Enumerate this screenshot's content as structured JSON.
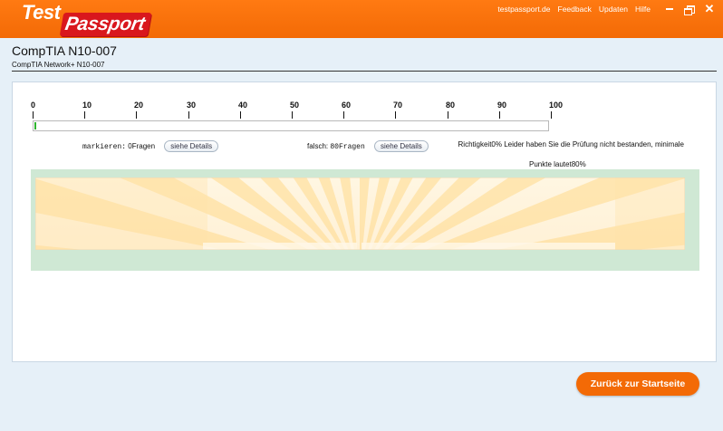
{
  "brand": {
    "logo_test": "Test",
    "logo_passport": "Passport",
    "color_primary": "#f36a06",
    "color_logo_badge": "#d9171d"
  },
  "topnav": {
    "links": [
      "testpassport.de",
      "Feedback",
      "Updaten",
      "Hilfe"
    ],
    "window_controls": [
      "minimize-icon",
      "restore-icon",
      "close-icon"
    ]
  },
  "exam": {
    "title": "CompTIA N10-007",
    "subtitle": "CompTIA Network+ N10-007"
  },
  "scale": {
    "ticks": [
      "0",
      "10",
      "20",
      "30",
      "40",
      "50",
      "60",
      "70",
      "80",
      "90",
      "100"
    ],
    "progress_percent": 0,
    "progress_color": "#2fb52f"
  },
  "stats": {
    "marked_label": "markieren:",
    "marked_value": "0Fragen",
    "marked_button": "siehe Details",
    "wrong_label": "falsch:",
    "wrong_value": "80Fragen",
    "wrong_button": "siehe Details",
    "result_line1": "Richtigkeit0% Leider haben Sie die Prüfung nicht bestanden, minimale",
    "result_line2": "Punkte lautet80%"
  },
  "actions": {
    "back_button": "Zurück zur Startseite"
  }
}
